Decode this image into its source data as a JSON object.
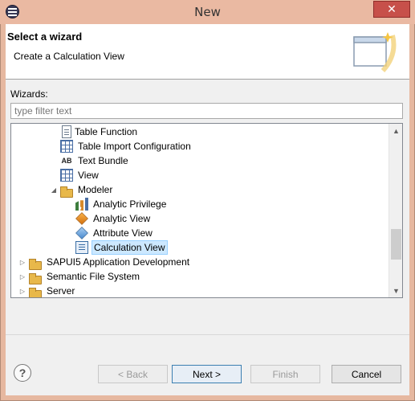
{
  "window": {
    "title": "New",
    "close_glyph": "✕"
  },
  "header": {
    "title": "Select a wizard",
    "description": "Create a Calculation View"
  },
  "wizards": {
    "label": "Wizards:",
    "filter_placeholder": "type filter text"
  },
  "tree": {
    "items": [
      {
        "label": "Table Function",
        "icon": "table-function-icon"
      },
      {
        "label": "Table Import Configuration",
        "icon": "table-import-icon"
      },
      {
        "label": "Text Bundle",
        "icon": "text-bundle-icon"
      },
      {
        "label": "View",
        "icon": "view-icon"
      },
      {
        "label": "Modeler",
        "icon": "folder-icon",
        "expanded": true
      },
      {
        "label": "Analytic Privilege",
        "icon": "analytic-privilege-icon"
      },
      {
        "label": "Analytic View",
        "icon": "analytic-view-icon"
      },
      {
        "label": "Attribute View",
        "icon": "attribute-view-icon"
      },
      {
        "label": "Calculation View",
        "icon": "calculation-view-icon",
        "selected": true
      },
      {
        "label": "SAPUI5 Application Development",
        "icon": "folder-icon",
        "expanded": false
      },
      {
        "label": "Semantic File System",
        "icon": "folder-icon",
        "expanded": false
      },
      {
        "label": "Server",
        "icon": "folder-icon",
        "expanded": false
      }
    ]
  },
  "buttons": {
    "help": "?",
    "back": "< Back",
    "next": "Next >",
    "finish": "Finish",
    "cancel": "Cancel"
  },
  "colors": {
    "title_bar": "#eab9a2",
    "close_button": "#c7504a",
    "selection": "#cce8ff"
  }
}
